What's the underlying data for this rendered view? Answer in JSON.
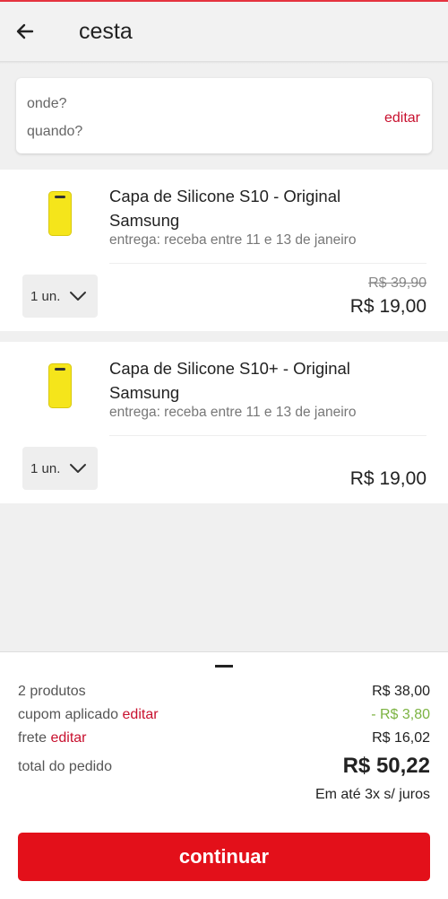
{
  "header": {
    "title": "cesta",
    "back_icon": "arrow-left-icon"
  },
  "location_card": {
    "where_placeholder": "onde?",
    "when_placeholder": "quando?",
    "edit_label": "editar"
  },
  "products": [
    {
      "name": "Capa de Silicone S10 - Original Samsung",
      "delivery": "entrega: receba entre 11 e 13 de janeiro",
      "quantity": "1 un.",
      "old_price": "R$ 39,90",
      "price": "R$ 19,00"
    },
    {
      "name": "Capa de Silicone S10+ - Original Samsung",
      "delivery": "entrega: receba entre 11 e 13 de janeiro",
      "quantity": "1 un.",
      "price": "R$ 19,00"
    }
  ],
  "summary": {
    "products_label": "2 produtos",
    "products_value": "R$ 38,00",
    "coupon_label": "cupom aplicado",
    "coupon_edit": "editar",
    "coupon_value": "- R$ 3,80",
    "shipping_label": "frete",
    "shipping_edit": "editar",
    "shipping_value": "R$ 16,02",
    "total_label": "total do pedido",
    "total_value": "R$ 50,22",
    "installments": "Em até 3x s/ juros",
    "continue_label": "continuar"
  },
  "colors": {
    "accent": "#e3101a",
    "link": "#c8102e",
    "discount": "#7cb342",
    "product_yellow": "#f5e51b"
  }
}
